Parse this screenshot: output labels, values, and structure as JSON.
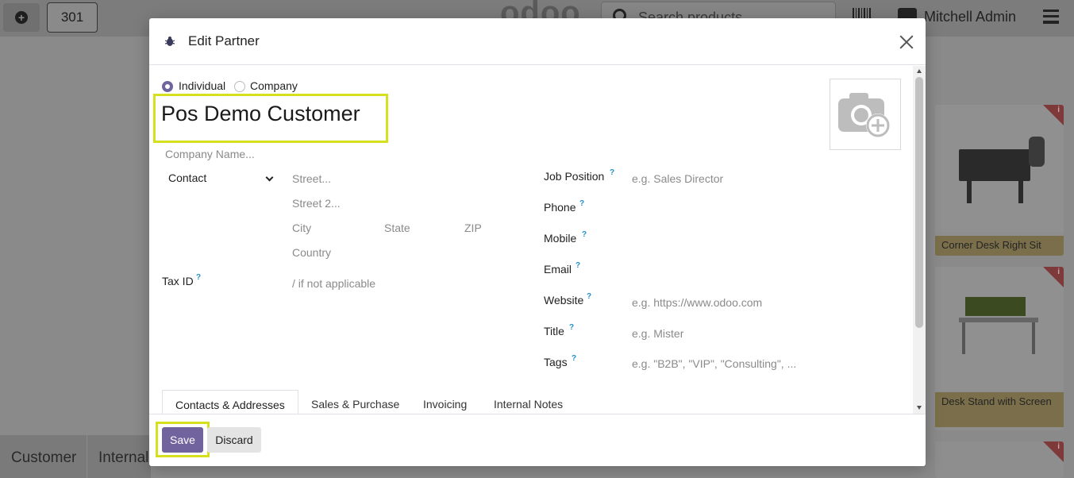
{
  "background": {
    "order_number": "301",
    "logo_text": "odoo",
    "search_placeholder": "Search products...",
    "user_name": "Mitchell Admin",
    "products": [
      {
        "name": "Corner Desk Right Sit"
      },
      {
        "name": "Desk Stand with Screen"
      }
    ],
    "bottom_tabs": [
      "Customer",
      "Internal"
    ]
  },
  "modal": {
    "title": "Edit Partner",
    "type_options": [
      {
        "label": "Individual",
        "checked": true
      },
      {
        "label": "Company",
        "checked": false
      }
    ],
    "partner_name": "Pos Demo Customer",
    "company_name_placeholder": "Company Name...",
    "address_type": "Contact",
    "address": {
      "street_placeholder": "Street...",
      "street2_placeholder": "Street 2...",
      "city_placeholder": "City",
      "state_placeholder": "State",
      "zip_placeholder": "ZIP",
      "country_placeholder": "Country"
    },
    "tax_id": {
      "label": "Tax ID",
      "placeholder": "/ if not applicable"
    },
    "right_fields": [
      {
        "label": "Job Position",
        "placeholder": "e.g. Sales Director"
      },
      {
        "label": "Phone",
        "placeholder": ""
      },
      {
        "label": "Mobile",
        "placeholder": ""
      },
      {
        "label": "Email",
        "placeholder": ""
      },
      {
        "label": "Website",
        "placeholder": "e.g. https://www.odoo.com"
      },
      {
        "label": "Title",
        "placeholder": "e.g. Mister"
      },
      {
        "label": "Tags",
        "placeholder": "e.g. \"B2B\", \"VIP\", \"Consulting\", ..."
      }
    ],
    "help_mark": "?",
    "tabs": [
      {
        "label": "Contacts & Addresses",
        "active": true
      },
      {
        "label": "Sales & Purchase",
        "active": false
      },
      {
        "label": "Invoicing",
        "active": false
      },
      {
        "label": "Internal Notes",
        "active": false
      }
    ],
    "footer": {
      "save_label": "Save",
      "discard_label": "Discard"
    }
  },
  "colors": {
    "primary": "#71639e",
    "highlight": "#d7e01f",
    "help": "#1f8fc9"
  }
}
